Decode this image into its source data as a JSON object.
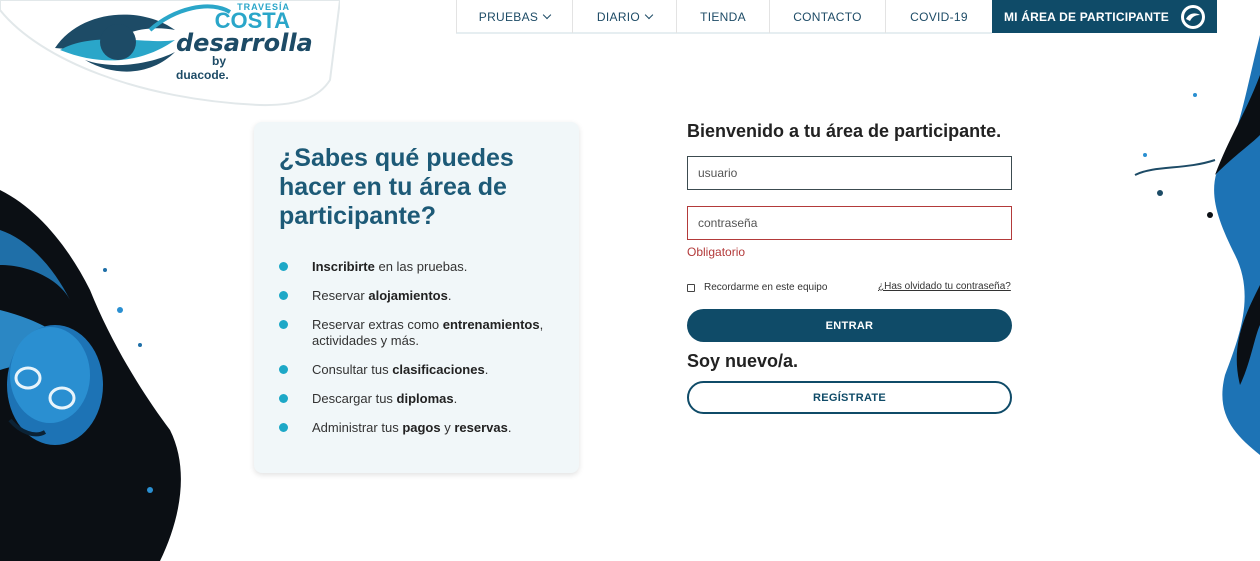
{
  "brand": {
    "small": "TRAVESÍA",
    "name": "COSTA",
    "tagline": "desarrolla",
    "by": "by duacode."
  },
  "nav": {
    "items": [
      {
        "label": "PRUEBAS",
        "dropdown": true
      },
      {
        "label": "DIARIO",
        "dropdown": true
      },
      {
        "label": "TIENDA",
        "dropdown": false
      },
      {
        "label": "CONTACTO",
        "dropdown": false
      },
      {
        "label": "COVID-19",
        "dropdown": false
      }
    ],
    "cta": "MI ÁREA DE PARTICIPANTE"
  },
  "info": {
    "title": "¿Sabes qué puedes hacer en tu área de participante?",
    "benefits": [
      {
        "pre": "",
        "strong": "Inscribirte",
        "post": " en las pruebas."
      },
      {
        "pre": "Reservar ",
        "strong": "alojamientos",
        "post": "."
      },
      {
        "pre": "Reservar extras como ",
        "strong": "entrenamientos",
        "post": ", actividades y más."
      },
      {
        "pre": "Consultar tus ",
        "strong": "clasificaciones",
        "post": "."
      },
      {
        "pre": "Descargar tus ",
        "strong": "diplomas",
        "post": "."
      },
      {
        "pre": "Administrar tus ",
        "strong": "pagos",
        "mid": " y ",
        "strong2": "reservas",
        "post": "."
      }
    ]
  },
  "login": {
    "welcome": "Bienvenido a tu área de participante.",
    "username_placeholder": "usuario",
    "password_placeholder": "contraseña",
    "error": "Obligatorio",
    "remember": "Recordarme en este equipo",
    "forgot": "¿Has olvidado tu contraseña?",
    "submit": "ENTRAR"
  },
  "register": {
    "title": "Soy nuevo/a.",
    "button": "REGÍSTRATE"
  },
  "colors": {
    "primary": "#0f4b68",
    "accent": "#1da8c7",
    "error": "#b33a3a"
  }
}
